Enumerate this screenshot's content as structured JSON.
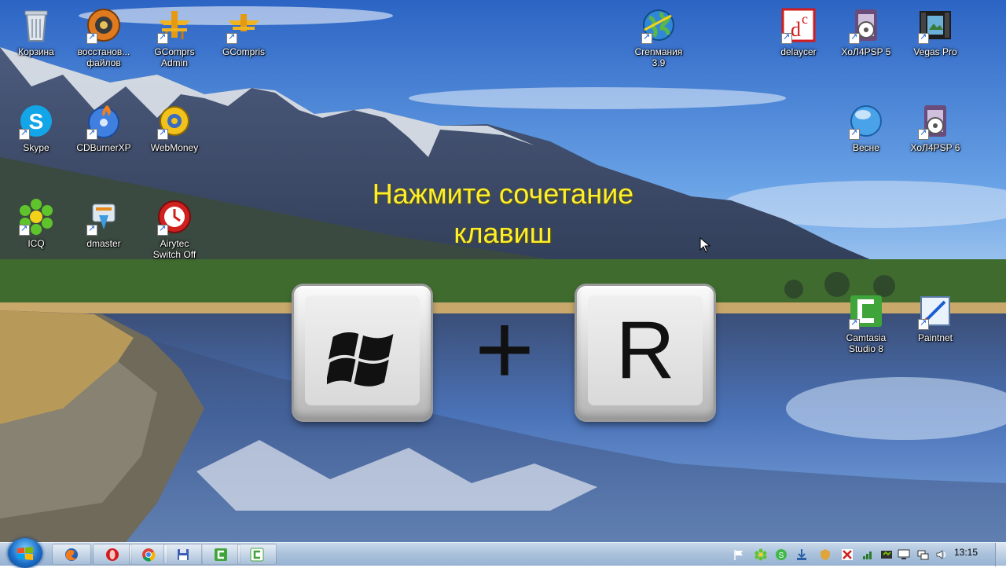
{
  "overlay": {
    "line1": "Нажмите сочетание",
    "line2": "клавиш",
    "plus": "+",
    "key_letter": "R"
  },
  "desktop_icons": [
    {
      "label": "Корзина",
      "icon": "recycle-bin-icon"
    },
    {
      "label": "восстанов...\nфайлов",
      "icon": "file-recovery-icon"
    },
    {
      "label": "GComprs\nAdmin",
      "icon": "gcompris-icon"
    },
    {
      "label": "GCompris",
      "icon": "gcompris-icon"
    },
    {
      "label": "Skype",
      "icon": "skype-icon"
    },
    {
      "label": "CDBurnerXP",
      "icon": "cdburner-icon"
    },
    {
      "label": "WebMoney",
      "icon": "webmoney-icon"
    },
    {
      "label": "ICQ",
      "icon": "icq-icon"
    },
    {
      "label": "dmaster",
      "icon": "download-master-icon"
    },
    {
      "label": "Airytec\nSwitch Off",
      "icon": "switch-off-icon"
    },
    {
      "label": "Crenмания\n3.9",
      "icon": "globe-icon"
    },
    {
      "label": "delaycer",
      "icon": "delaycer-icon"
    },
    {
      "label": "ХоЛ4PSP 5",
      "icon": "film-icon"
    },
    {
      "label": "Vegas Pro",
      "icon": "vegas-pro-icon"
    },
    {
      "label": "Весне",
      "icon": "weather-globe-icon"
    },
    {
      "label": "ХоЛ4PSP 6",
      "icon": "film-icon"
    },
    {
      "label": "Camtasia\nStudio 8",
      "icon": "camtasia-icon"
    },
    {
      "label": "Paintnet",
      "icon": "paint-icon"
    }
  ],
  "taskbar": {
    "clock": "13:15",
    "pinned": [
      "firefox-icon",
      "opera-icon",
      "chrome-icon",
      "disk-icon",
      "camtasia-recorder-icon",
      "camtasia-icon"
    ]
  },
  "colors": {
    "overlay_text": "#ffee2b",
    "taskbar": "#a9c1db"
  }
}
